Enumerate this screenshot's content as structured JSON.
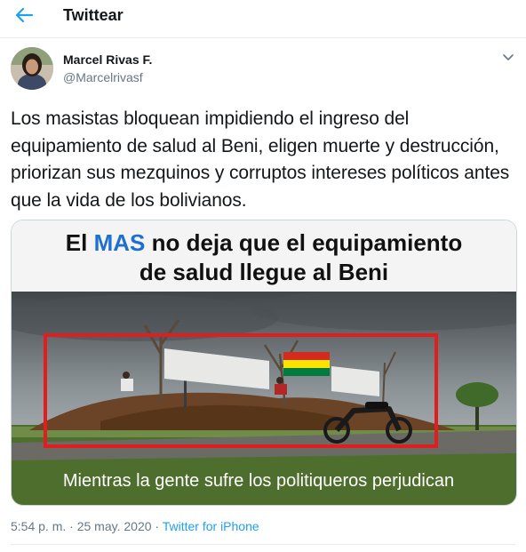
{
  "header": {
    "title": "Twittear",
    "back_icon": "arrow-left-icon",
    "accent": "#1da1f2"
  },
  "user": {
    "name": "Marcel Rivas F.",
    "handle": "@Marcelrivasf"
  },
  "tweet": {
    "text": "Los masistas bloquean impidiendo el ingreso del equipamiento de salud al Beni, eligen muerte y destrucción, priorizan sus mezquinos y corruptos intereses políticos antes que la vida de los bolivianos."
  },
  "image": {
    "headline_pre": "El ",
    "headline_highlight": "MAS",
    "headline_post": " no deja que el equipamiento",
    "headline_line2": "de salud llegue al Beni",
    "caption": "Mientras la gente sufre los politiqueros perjudican",
    "highlight_color": "#1f6fd1",
    "frame_color": "#e11d1d"
  },
  "meta": {
    "time": "5:54 p. m.",
    "sep": " · ",
    "date": "25 may. 2020",
    "source": "Twitter for iPhone"
  }
}
